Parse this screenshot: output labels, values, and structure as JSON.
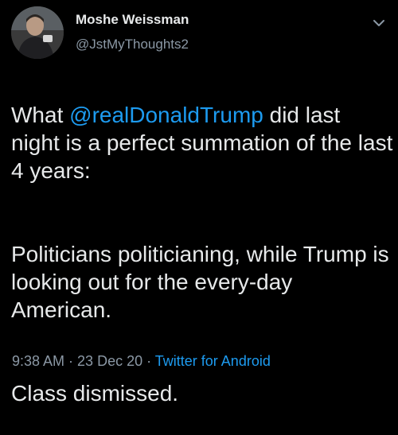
{
  "author": {
    "display_name": "Moshe Weissman",
    "handle": "@JstMyThoughts2",
    "avatar_icon": "profile-photo"
  },
  "menu": {
    "icon": "chevron-down-icon"
  },
  "tweet": {
    "line1_before": "What ",
    "mention": "@realDonaldTrump",
    "line1_after": " did last night is a perfect summation of the last 4 years:",
    "paragraph2": "Politicians politicianing, while Trump is looking out for the every-day American.",
    "paragraph3": "Class dismissed."
  },
  "meta": {
    "time": "9:38 AM",
    "separator": " · ",
    "date": "23 Dec 20",
    "source": "Twitter for Android"
  },
  "colors": {
    "background": "#000000",
    "text": "#e7e9ea",
    "secondary": "#8b98a5",
    "link": "#1d9bf0"
  }
}
